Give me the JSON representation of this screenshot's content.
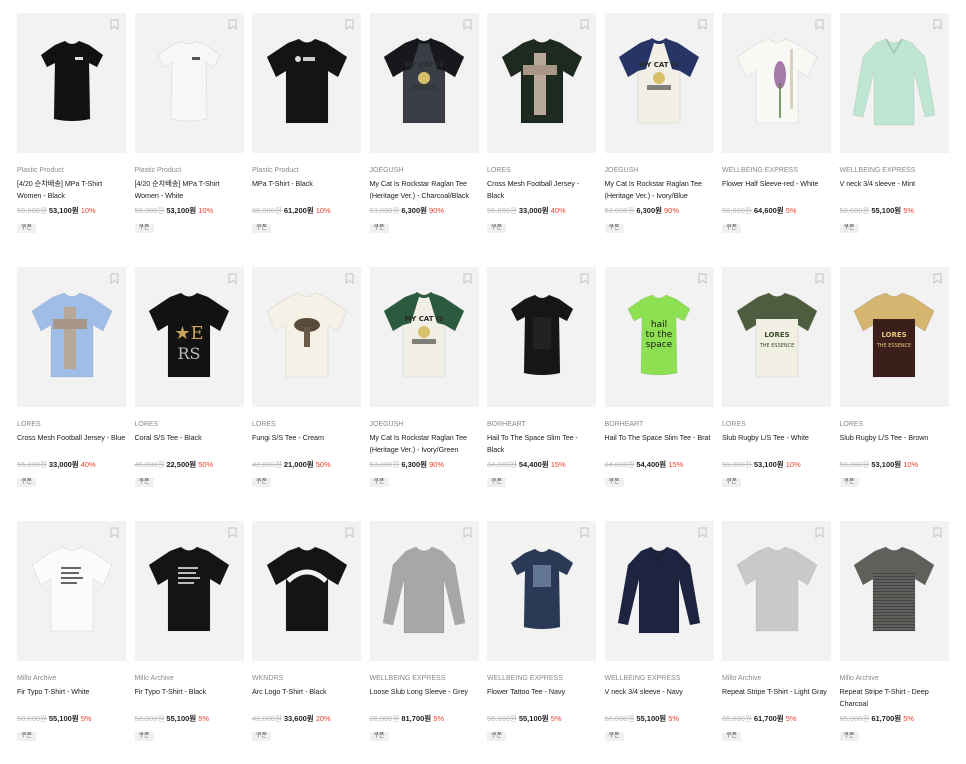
{
  "coupon_label": "쿠폰",
  "products": [
    {
      "brand": "Plastic Product",
      "name": "[4/20 순차배송] MPa T-Shirt Women - Black",
      "original": "59,000원",
      "sale": "53,100원",
      "discount": "10%",
      "icon": "tshirt-fitted-black"
    },
    {
      "brand": "Plastic Product",
      "name": "[4/20 순차배송] MPa T-Shirt Women - White",
      "original": "59,000원",
      "sale": "53,100원",
      "discount": "10%",
      "icon": "tshirt-fitted-white"
    },
    {
      "brand": "Plastic Product",
      "name": "MPa T-Shirt - Black",
      "original": "68,000원",
      "sale": "61,200원",
      "discount": "10%",
      "icon": "tshirt-black"
    },
    {
      "brand": "JOEGUSH",
      "name": "My Cat Is Rockstar Raglan Tee (Heritage Ver.) - Charcoal/Black",
      "original": "63,000원",
      "sale": "6,300원",
      "discount": "90%",
      "icon": "raglan-charcoal"
    },
    {
      "brand": "LORES",
      "name": "Cross Mesh Football Jersey - Black",
      "original": "55,000원",
      "sale": "33,000원",
      "discount": "40%",
      "icon": "jersey-black"
    },
    {
      "brand": "JOEGUSH",
      "name": "My Cat Is Rockstar Raglan Tee (Heritage Ver.) - Ivory/Blue",
      "original": "63,000원",
      "sale": "6,300원",
      "discount": "90%",
      "icon": "raglan-blue"
    },
    {
      "brand": "WELLBEING EXPRESS",
      "name": "Flower Half Sleeve-red - White",
      "original": "68,000원",
      "sale": "64,600원",
      "discount": "5%",
      "icon": "tshirt-flower-white"
    },
    {
      "brand": "WELLBEING EXPRESS",
      "name": "V neck 3/4 sleeve - Mint",
      "original": "58,000원",
      "sale": "55,100원",
      "discount": "5%",
      "icon": "vneck-mint"
    },
    {
      "brand": "LORES",
      "name": "Cross Mesh Football Jersey - Blue",
      "original": "55,000원",
      "sale": "33,000원",
      "discount": "40%",
      "icon": "jersey-blue"
    },
    {
      "brand": "LORES",
      "name": "Coral S/S Tee - Black",
      "original": "45,000원",
      "sale": "22,500원",
      "discount": "50%",
      "icon": "tshirt-black-print"
    },
    {
      "brand": "LORES",
      "name": "Fungi S/S Tee - Cream",
      "original": "42,000원",
      "sale": "21,000원",
      "discount": "50%",
      "icon": "tshirt-cream-print"
    },
    {
      "brand": "JOEGUSH",
      "name": "My Cat Is Rockstar Raglan Tee (Heritage Ver.) - Ivory/Green",
      "original": "63,000원",
      "sale": "6,300원",
      "discount": "90%",
      "icon": "raglan-green"
    },
    {
      "brand": "BORHEART",
      "name": "Hail To The Space Slim Tee - Black",
      "original": "64,000원",
      "sale": "54,400원",
      "discount": "15%",
      "icon": "slim-black"
    },
    {
      "brand": "BORHEART",
      "name": "Hail To The Space Slim Tee - Brat",
      "original": "64,000원",
      "sale": "54,400원",
      "discount": "15%",
      "icon": "slim-green"
    },
    {
      "brand": "LORES",
      "name": "Slub Rugby L/S Tee - White",
      "original": "59,000원",
      "sale": "53,100원",
      "discount": "10%",
      "icon": "rugby-white"
    },
    {
      "brand": "LORES",
      "name": "Slub Rugby L/S Tee - Brown",
      "original": "59,000원",
      "sale": "53,100원",
      "discount": "10%",
      "icon": "rugby-brown"
    },
    {
      "brand": "Millo Archive",
      "name": "Fir Typo T-Shirt - White",
      "original": "58,000원",
      "sale": "55,100원",
      "discount": "5%",
      "icon": "tshirt-white-text"
    },
    {
      "brand": "Millo Archive",
      "name": "Fir Typo T-Shirt - Black",
      "original": "58,000원",
      "sale": "55,100원",
      "discount": "5%",
      "icon": "tshirt-black-text"
    },
    {
      "brand": "WKNDRS",
      "name": "Arc Logo T-Shirt - Black",
      "original": "42,000원",
      "sale": "33,600원",
      "discount": "20%",
      "icon": "tshirt-black-arc-logo"
    },
    {
      "brand": "WELLBEING EXPRESS",
      "name": "Loose Slub Long Sleeve - Grey",
      "original": "86,000원",
      "sale": "81,700원",
      "discount": "5%",
      "icon": "longsleeve-grey"
    },
    {
      "brand": "WELLBEING EXPRESS",
      "name": "Flower Tattoo Tee - Navy",
      "original": "58,000원",
      "sale": "55,100원",
      "discount": "5%",
      "icon": "tshirt-navy-print"
    },
    {
      "brand": "WELLBEING EXPRESS",
      "name": "V neck 3/4 sleeve - Navy",
      "original": "58,000원",
      "sale": "55,100원",
      "discount": "5%",
      "icon": "vneck-navy"
    },
    {
      "brand": "Millo Archive",
      "name": "Repeat Stripe T-Shirt - Light Gray",
      "original": "65,000원",
      "sale": "61,700원",
      "discount": "5%",
      "icon": "tshirt-lightgray"
    },
    {
      "brand": "Millo Archive",
      "name": "Repeat Stripe T-Shirt - Deep Charcoal",
      "original": "65,000원",
      "sale": "61,700원",
      "discount": "5%",
      "icon": "tshirt-charcoal"
    }
  ]
}
